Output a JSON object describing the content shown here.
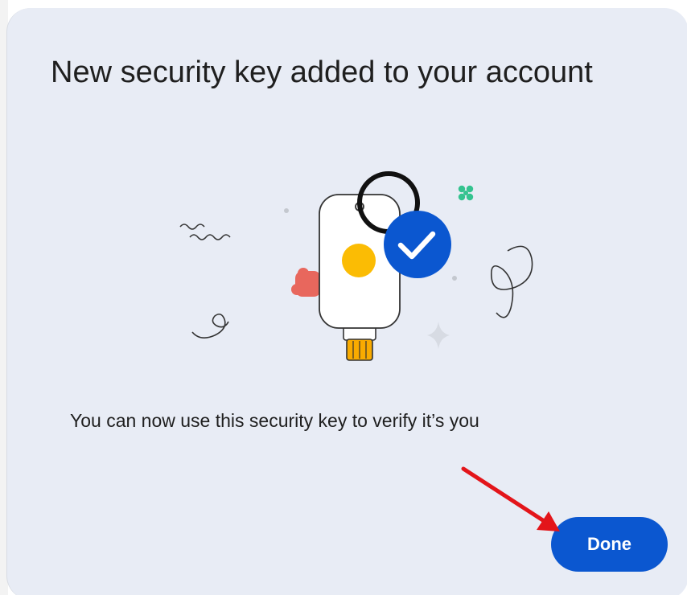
{
  "dialog": {
    "title": "New security key added to your account",
    "message": "You can now use this security key to verify it’s you",
    "done_label": "Done"
  },
  "illustration": {
    "icon": "security-key-with-checkmark-icon",
    "colors": {
      "key_body": "#ffffff",
      "key_button": "#fbbc04",
      "key_connector": "#f9ab00",
      "check_badge": "#0b57d0",
      "red_blob": "#e8675d",
      "green_clover": "#34c38f"
    }
  },
  "annotation": {
    "arrow_icon": "red-arrow-icon",
    "color": "#e3151a"
  },
  "colors": {
    "dialog_background": "#e8ecf5",
    "primary_button": "#0b57d0",
    "text": "#1f1f1f"
  }
}
